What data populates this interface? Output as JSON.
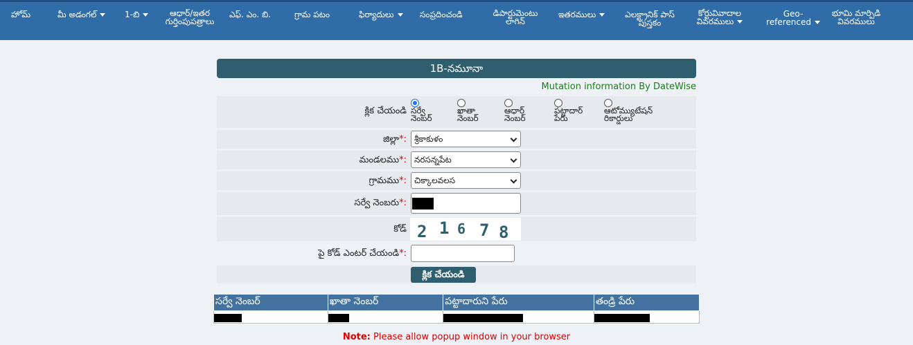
{
  "nav": {
    "items": [
      {
        "label": "హోమ్",
        "dropdown": false
      },
      {
        "label": "మీ అడంగల్",
        "dropdown": true
      },
      {
        "label": "1-బి",
        "dropdown": true
      },
      {
        "label": "ఆధార్/ఇతర గుర్తింపుపత్రాలు",
        "dropdown": false
      },
      {
        "label": "ఎఫ్. ఎం. బి.",
        "dropdown": false
      },
      {
        "label": "గ్రామ పటం",
        "dropdown": false
      },
      {
        "label": "ఫిర్యాదులు",
        "dropdown": true
      },
      {
        "label": "సంప్రదించండి",
        "dropdown": false
      },
      {
        "label": "డిపార్టుమెంటు లాగిన్",
        "dropdown": false
      },
      {
        "label": "ఇతరములు",
        "dropdown": true
      },
      {
        "label": "ఎలక్ట్రానిక్ పాస్ పుస్తకం",
        "dropdown": false
      },
      {
        "label": "కోర్టువివాదాల వివరములు",
        "dropdown": true
      },
      {
        "label": "Geo-referenced",
        "dropdown": true
      },
      {
        "label": "భూమి మార్పిడి వివరములు",
        "dropdown": false
      }
    ]
  },
  "form": {
    "title": "1B-నమూనా",
    "mutation_link": "Mutation information By DateWise",
    "click_label": "క్లిక చేయండి",
    "radios": [
      {
        "label": "సర్వే నెంబర్",
        "checked": true
      },
      {
        "label": "ఖాతా నెంబర్",
        "checked": false
      },
      {
        "label": "ఆధార్ నెంబర్",
        "checked": false
      },
      {
        "label": "పట్టాదార్ పేరు",
        "checked": false
      },
      {
        "label": "ఆటోమ్యుటేషన్ రికార్డులు",
        "checked": false
      }
    ],
    "district_label": "జిల్లా",
    "district_value": "శ్రీకాకుళం",
    "mandal_label": "మండలము",
    "mandal_value": "నరసన్నపేట",
    "village_label": "గ్రామము",
    "village_value": "చిక్కాలవలస",
    "survey_label": "సర్వే నెంబరు",
    "required_mark": "*:",
    "code_label": "కోడ్",
    "captcha_digits": [
      "2",
      "1",
      "6",
      "7",
      "8"
    ],
    "enter_code_label": "పై కోడ్ ఎంటర్ చేయండి",
    "submit_label": "క్లిక చేయండి"
  },
  "table": {
    "headers": [
      "సర్వే నెంబర్",
      "ఖాతా నెంబర్",
      "పట్టాదారుని పేరు",
      "తండ్రి పేరు"
    ]
  },
  "note": {
    "prefix": "Note:",
    "text": " Please allow popup window in your browser"
  },
  "colors": {
    "nav_bg": "#2f6ca8",
    "panel_title_bg": "#2f5f6f",
    "table_header_bg": "#4472a0",
    "note_red": "#dd0000",
    "link_green": "#1f7a1f"
  }
}
